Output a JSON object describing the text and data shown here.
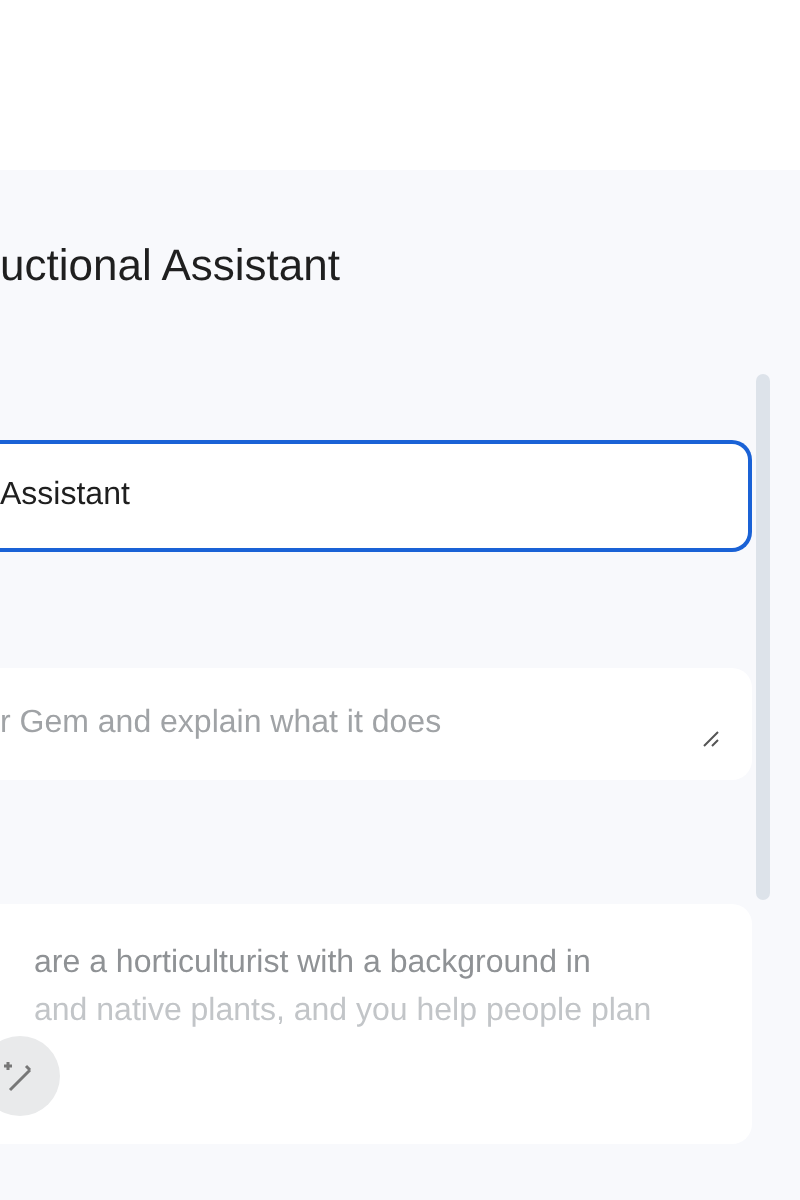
{
  "header": {
    "title": "uctional Assistant"
  },
  "name_field": {
    "value": "Assistant",
    "focused": true
  },
  "description_field": {
    "placeholder": "r Gem and explain what it does"
  },
  "instructions_field": {
    "lines": [
      "are a horticulturist with a background in",
      "and native plants, and you help people plan"
    ]
  }
}
